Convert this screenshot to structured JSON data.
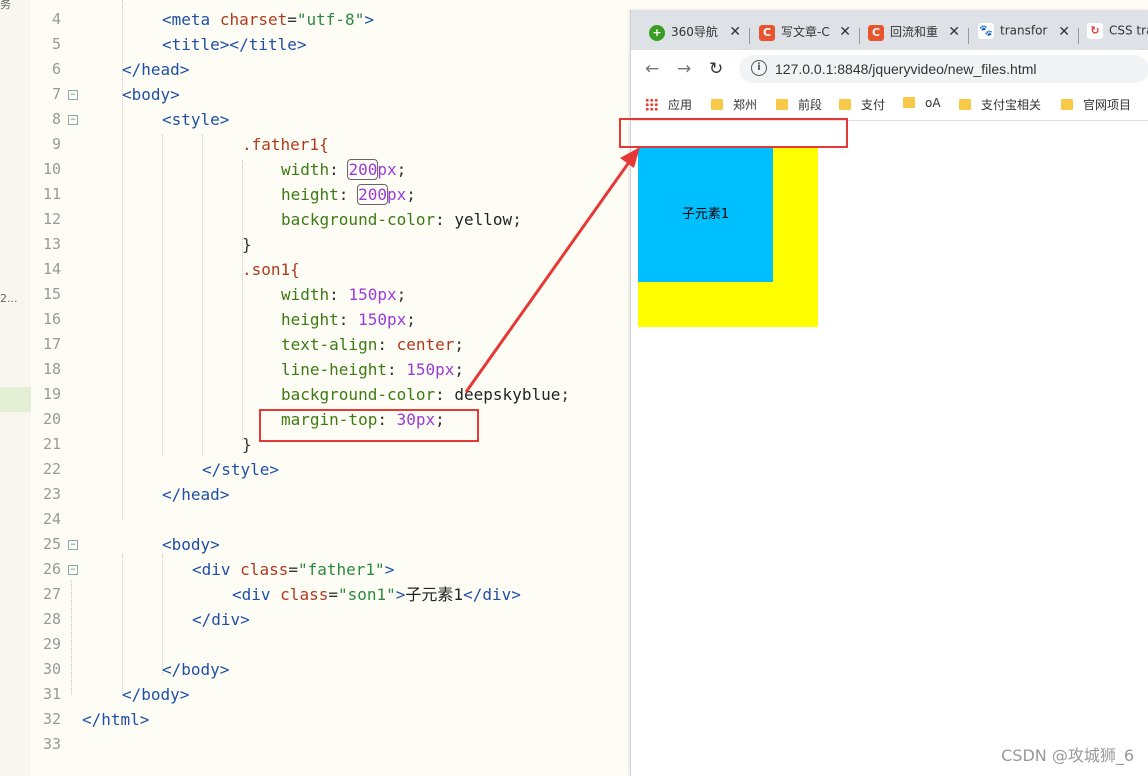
{
  "editor": {
    "lines": [
      {
        "n": "4",
        "fold": false
      },
      {
        "n": "5",
        "fold": false
      },
      {
        "n": "6",
        "fold": false
      },
      {
        "n": "7",
        "fold": true
      },
      {
        "n": "8",
        "fold": true
      },
      {
        "n": "9",
        "fold": false
      },
      {
        "n": "10",
        "fold": false
      },
      {
        "n": "11",
        "fold": false
      },
      {
        "n": "12",
        "fold": false
      },
      {
        "n": "13",
        "fold": false
      },
      {
        "n": "14",
        "fold": false
      },
      {
        "n": "15",
        "fold": false
      },
      {
        "n": "16",
        "fold": false
      },
      {
        "n": "17",
        "fold": false
      },
      {
        "n": "18",
        "fold": false
      },
      {
        "n": "19",
        "fold": false
      },
      {
        "n": "20",
        "fold": false
      },
      {
        "n": "21",
        "fold": false
      },
      {
        "n": "22",
        "fold": false
      },
      {
        "n": "23",
        "fold": false
      },
      {
        "n": "24",
        "fold": false
      },
      {
        "n": "25",
        "fold": true
      },
      {
        "n": "26",
        "fold": true
      },
      {
        "n": "27",
        "fold": false
      },
      {
        "n": "28",
        "fold": false
      },
      {
        "n": "29",
        "fold": false
      },
      {
        "n": "30",
        "fold": false
      },
      {
        "n": "31",
        "fold": false
      },
      {
        "n": "32",
        "fold": false
      },
      {
        "n": "33",
        "fold": false
      }
    ],
    "code": {
      "l4_attr": "charset",
      "l4_val": "\"utf-8\"",
      "father_sel": ".father1{",
      "width_prop": "width",
      "w200": "200",
      "px": "px",
      "height_prop": "height",
      "h200": "200",
      "bg_prop": "background-color",
      "yellow": "yellow",
      "close_brace": "}",
      "son_sel": ".son1{",
      "w150": "150px",
      "h150": "150px",
      "ta_prop": "text-align",
      "center": "center",
      "lh_prop": "line-height",
      "lh150": "150px",
      "deepskyblue": "deepskyblue",
      "mt_prop": "margin-top",
      "mt30": "30px",
      "class_attr": "class",
      "father_cls": "\"father1\"",
      "son_cls": "\"son1\"",
      "son_text": "子元素1"
    },
    "left_fragment_1": "务",
    "left_fragment_2": "2..."
  },
  "browser": {
    "tabs": [
      {
        "label": "360导航",
        "icon": "360-icon",
        "color": "#3a9d23"
      },
      {
        "label": "写文章-C",
        "icon": "csdn-icon",
        "color": "#e8542e"
      },
      {
        "label": "回流和重",
        "icon": "csdn-icon",
        "color": "#e8542e"
      },
      {
        "label": "transfor",
        "icon": "baidu-icon",
        "color": "#2d4ef5"
      },
      {
        "label": "CSS tra",
        "icon": "css-site-icon",
        "color": "#e53935"
      }
    ],
    "url": "127.0.0.1:8848/jqueryvideo/new_files.html",
    "bookmarks": [
      {
        "label": "应用",
        "type": "apps"
      },
      {
        "label": "郑州",
        "type": "folder"
      },
      {
        "label": "前段",
        "type": "folder"
      },
      {
        "label": "支付",
        "type": "folder"
      },
      {
        "label": "oA",
        "type": "folder"
      },
      {
        "label": "支付宝相关",
        "type": "folder"
      },
      {
        "label": "官网项目",
        "type": "folder"
      }
    ],
    "page": {
      "son_text": "子元素1",
      "father_color": "#ffff00",
      "son_color": "#00bfff"
    },
    "watermark": "CSDN @攻城狮_6"
  },
  "annotation_color": "#e53935"
}
